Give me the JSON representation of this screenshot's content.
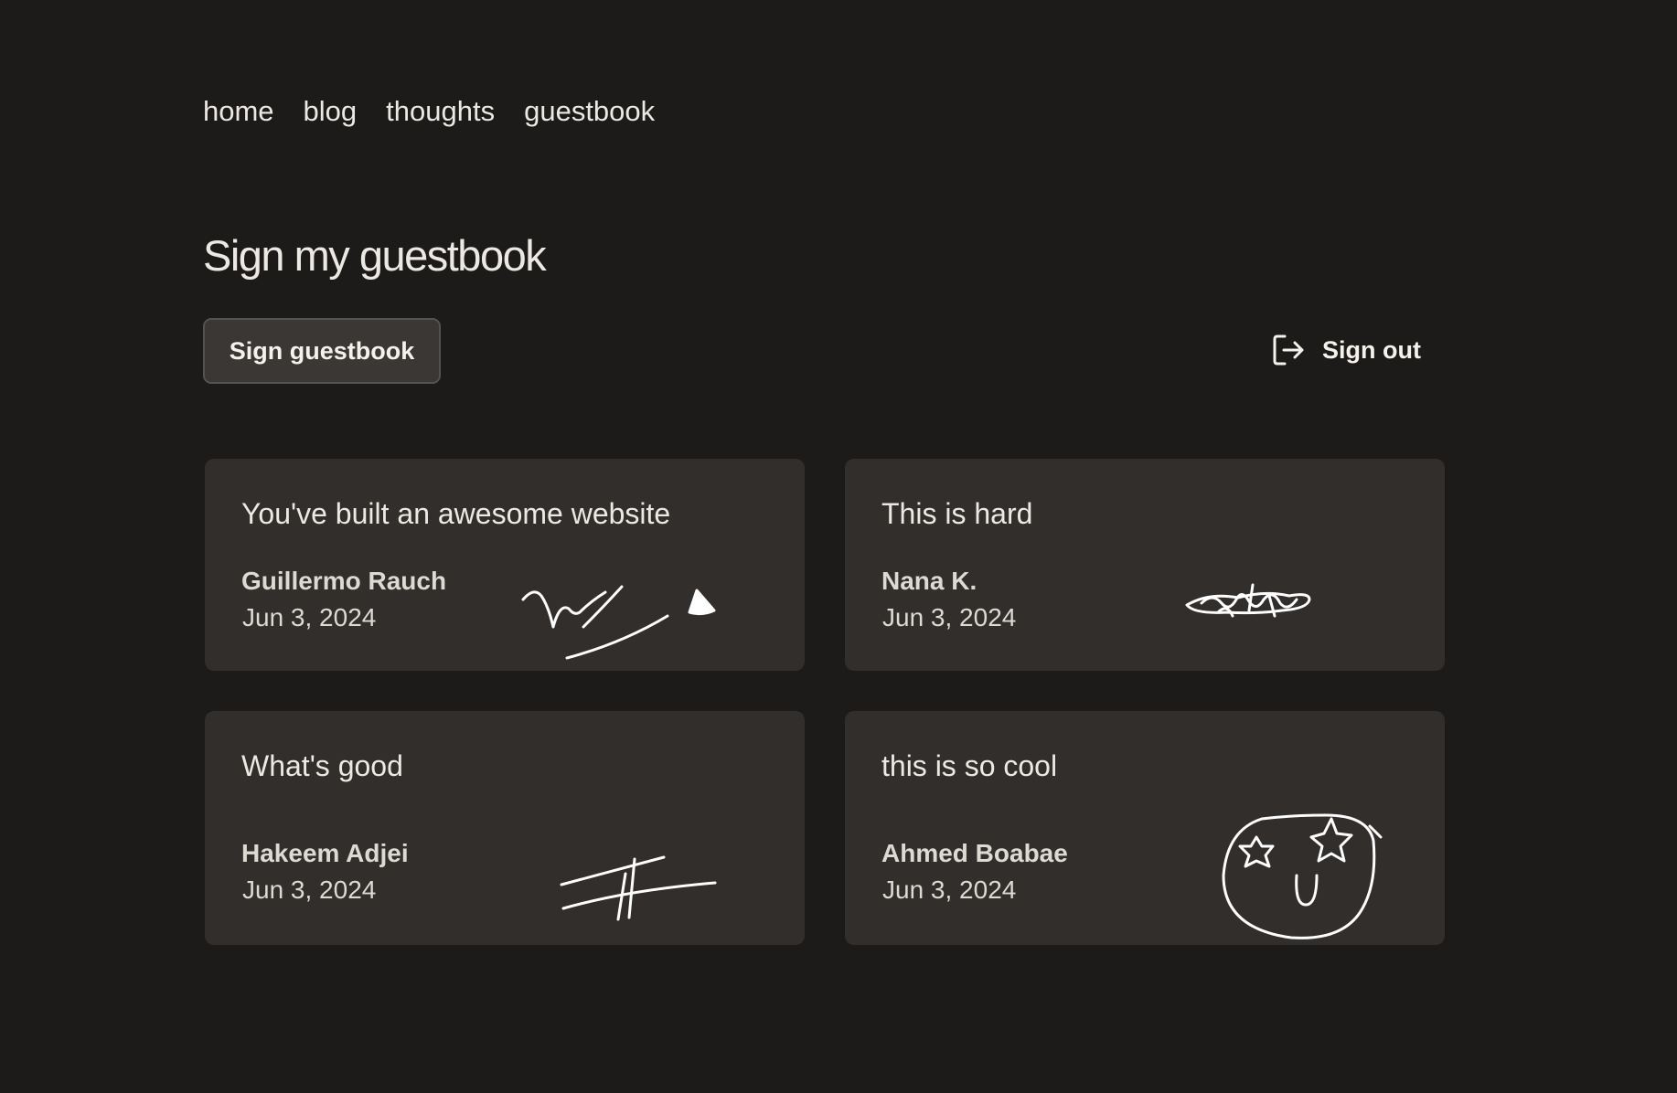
{
  "nav": {
    "items": [
      {
        "label": "home"
      },
      {
        "label": "blog"
      },
      {
        "label": "thoughts"
      },
      {
        "label": "guestbook"
      }
    ]
  },
  "page": {
    "title": "Sign my guestbook"
  },
  "actions": {
    "sign_label": "Sign guestbook",
    "signout_label": "Sign out",
    "signout_icon": "sign-out-icon"
  },
  "entries": [
    {
      "message": "You've built an awesome website",
      "author": "Guillermo Rauch",
      "date": "Jun 3, 2024"
    },
    {
      "message": "This is hard",
      "author": "Nana K.",
      "date": "Jun 3, 2024"
    },
    {
      "message": "What's good",
      "author": "Hakeem Adjei",
      "date": "Jun 3, 2024"
    },
    {
      "message": "this is so cool",
      "author": "Ahmed Boabae",
      "date": "Jun 3, 2024"
    }
  ],
  "colors": {
    "background": "#1c1b19",
    "card": "#312e2c",
    "button": "#3a3735",
    "text": "#ece9e4"
  }
}
